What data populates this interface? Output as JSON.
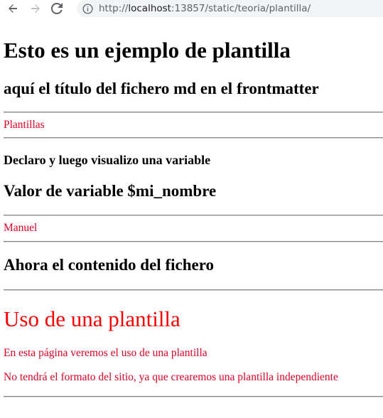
{
  "browser": {
    "url_scheme": "http://",
    "url_host": "localhost",
    "url_rest": ":13857/static/teoria/plantilla/"
  },
  "page": {
    "heading": "Esto es un ejemplo de plantilla",
    "subheading": "aquí el título del fichero md en el frontmatter",
    "section_label_1": "Plantillas",
    "declare_text": "Declaro y luego visualizo una variable",
    "variable_heading": "Valor de variable $mi_nombre",
    "variable_value": "Manuel",
    "content_heading": "Ahora el contenido del fichero",
    "content_title": "Uso de una plantilla",
    "content_p1": "En esta página veremos el uso de una plantilla",
    "content_p2": "No tendrá el formato del sitio, ya que crearemos una plantilla independiente"
  }
}
